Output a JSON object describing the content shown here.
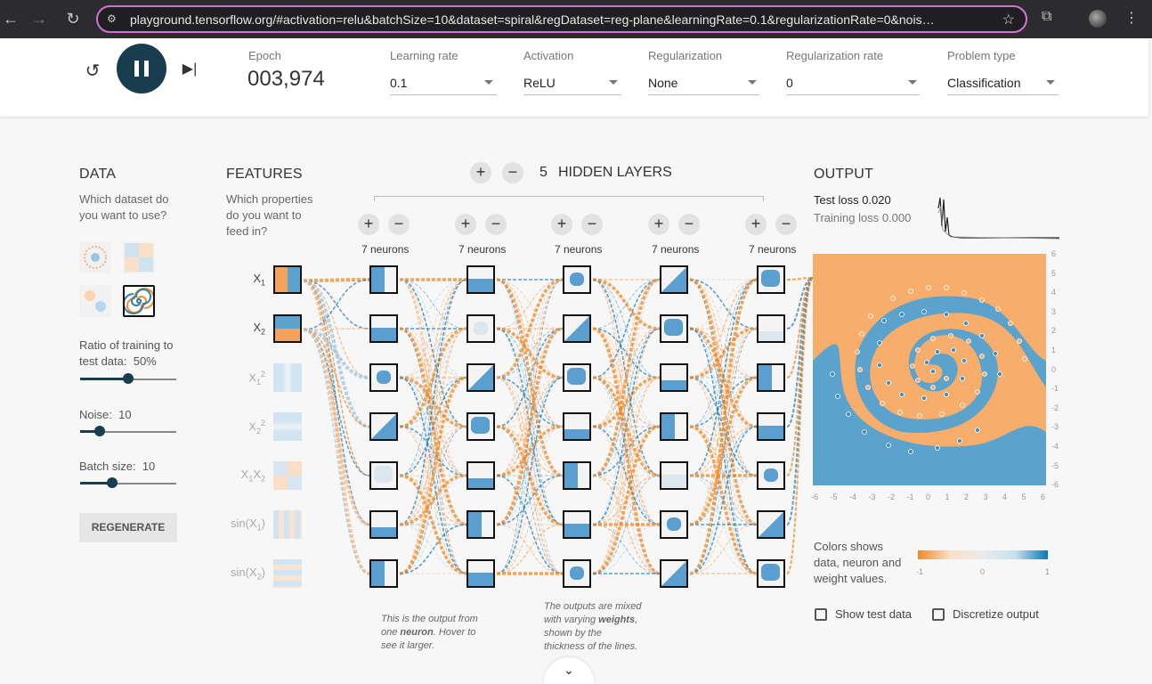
{
  "browser": {
    "url": "playground.tensorflow.org/#activation=relu&batchSize=10&dataset=spiral&regDataset=reg-plane&learningRate=0.1&regularizationRate=0&nois…"
  },
  "controls": {
    "epoch_label": "Epoch",
    "epoch_value": "003,974",
    "learning_rate": {
      "label": "Learning rate",
      "value": "0.1"
    },
    "activation": {
      "label": "Activation",
      "value": "ReLU"
    },
    "regularization": {
      "label": "Regularization",
      "value": "None"
    },
    "regularization_rate": {
      "label": "Regularization rate",
      "value": "0"
    },
    "problem_type": {
      "label": "Problem type",
      "value": "Classification"
    }
  },
  "data": {
    "title": "DATA",
    "question": "Which dataset do you want to use?",
    "ratio_label": "Ratio of training to test data:",
    "ratio_value": "50%",
    "ratio_level": 0.5,
    "noise_label": "Noise:",
    "noise_value": "10",
    "noise_level": 0.2,
    "batch_label": "Batch size:",
    "batch_value": "10",
    "batch_level": 0.33,
    "regenerate": "REGENERATE",
    "selected_dataset": "spiral"
  },
  "features": {
    "title": "FEATURES",
    "question": "Which properties do you want to feed in?",
    "items": [
      {
        "base": "X",
        "sub": "1",
        "sup": "",
        "active": true
      },
      {
        "base": "X",
        "sub": "2",
        "sup": "",
        "active": true
      },
      {
        "base": "X",
        "sub": "1",
        "sup": "2",
        "active": false
      },
      {
        "base": "X",
        "sub": "2",
        "sup": "2",
        "active": false
      },
      {
        "base": "X",
        "sub": "1",
        "sup": "",
        "active": false,
        "second": "X",
        "second_sub": "2"
      },
      {
        "base": "sin(X",
        "sub": "1",
        "sup": "",
        "active": false,
        "close": ")"
      },
      {
        "base": "sin(X",
        "sub": "2",
        "sup": "",
        "active": false,
        "close": ")"
      }
    ]
  },
  "network": {
    "hidden_layers_count": "5",
    "hidden_layers_label": "HIDDEN LAYERS",
    "layers": [
      {
        "neurons_label": "7 neurons"
      },
      {
        "neurons_label": "7 neurons"
      },
      {
        "neurons_label": "7 neurons"
      },
      {
        "neurons_label": "7 neurons"
      },
      {
        "neurons_label": "7 neurons"
      }
    ],
    "note1": [
      "This is the output",
      "from one ",
      "neuron",
      ". Hover to see it larger."
    ],
    "note2": [
      "The outputs are mixed with varying ",
      "weights",
      ", shown by the thickness of the lines."
    ]
  },
  "output": {
    "title": "OUTPUT",
    "test_loss_label": "Test loss",
    "test_loss": "0.020",
    "training_loss_label": "Training loss",
    "training_loss": "0.000",
    "x_ticks": [
      "-6",
      "-5",
      "-4",
      "-3",
      "-2",
      "-1",
      "0",
      "1",
      "2",
      "3",
      "4",
      "5",
      "6"
    ],
    "y_ticks": [
      "6",
      "5",
      "4",
      "3",
      "2",
      "1",
      "0",
      "-1",
      "-2",
      "-3",
      "-4",
      "-5",
      "-6"
    ],
    "legend_text": "Colors shows data, neuron and weight values.",
    "legend_ticks": [
      "-1",
      "0",
      "1"
    ],
    "show_test": "Show test data",
    "discretize": "Discretize output"
  },
  "colors": {
    "orange": "#f5a25d",
    "blue": "#5ba2cc",
    "dark": "#183d4e"
  }
}
